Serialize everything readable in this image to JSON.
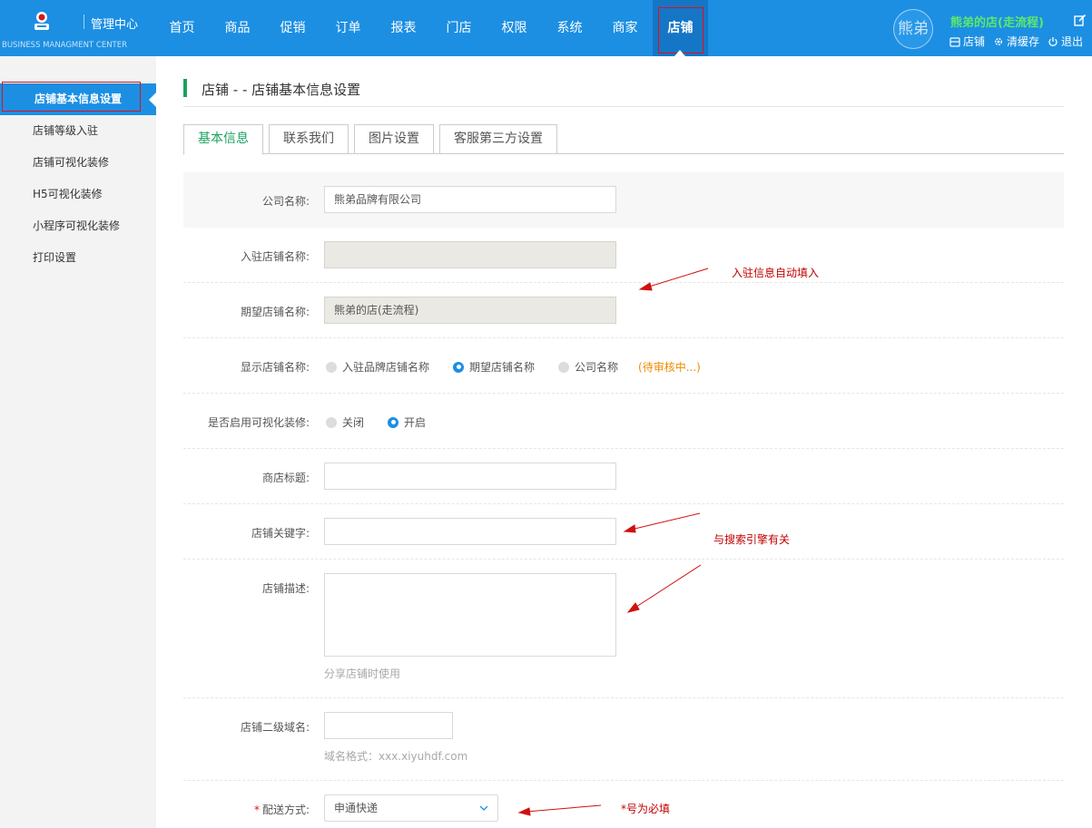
{
  "brand": {
    "title": "管理中心",
    "subtitle": "BUSINESS MANAGMENT CENTER"
  },
  "nav": {
    "items": [
      "首页",
      "商品",
      "促销",
      "订单",
      "报表",
      "门店",
      "权限",
      "系统",
      "商家",
      "店铺"
    ],
    "active": "店铺"
  },
  "user": {
    "avatar_text": "熊弟",
    "shop_name": "熊弟的店(走流程)",
    "links": [
      {
        "icon": "store-icon",
        "label": "店铺"
      },
      {
        "icon": "gear-icon",
        "label": "清缓存"
      },
      {
        "icon": "power-icon",
        "label": "退出"
      }
    ]
  },
  "sidebar": {
    "items": [
      "店铺基本信息设置",
      "店铺等级入驻",
      "店铺可视化装修",
      "H5可视化装修",
      "小程序可视化装修",
      "打印设置"
    ],
    "active": "店铺基本信息设置"
  },
  "page": {
    "title": "店铺 - - 店铺基本信息设置"
  },
  "tabs": {
    "items": [
      "基本信息",
      "联系我们",
      "图片设置",
      "客服第三方设置"
    ],
    "active": "基本信息"
  },
  "form": {
    "company_name": {
      "label": "公司名称:",
      "value": "熊弟品牌有限公司"
    },
    "settled_store_name": {
      "label": "入驻店铺名称:",
      "value": ""
    },
    "expected_store_name": {
      "label": "期望店铺名称:",
      "value": "熊弟的店(走流程)"
    },
    "display_store_name": {
      "label": "显示店铺名称:",
      "options": [
        "入驻品牌店铺名称",
        "期望店铺名称",
        "公司名称"
      ],
      "selected": "期望店铺名称",
      "status": "(待审核中...)"
    },
    "visual_decoration": {
      "label": "是否启用可视化装修:",
      "options": [
        "关闭",
        "开启"
      ],
      "selected": "开启"
    },
    "store_title": {
      "label": "商店标题:",
      "value": ""
    },
    "store_keywords": {
      "label": "店铺关键字:",
      "value": ""
    },
    "store_description": {
      "label": "店铺描述:",
      "value": "",
      "hint": "分享店铺时使用"
    },
    "subdomain": {
      "label": "店铺二级域名:",
      "value": "",
      "hint": "域名格式：xxx.xiyuhdf.com"
    },
    "delivery": {
      "required_mark": "*",
      "label": "配送方式:",
      "value": "申通快递"
    }
  },
  "annotations": {
    "auto_fill": "入驻信息自动填入",
    "seo": "与搜索引擎有关",
    "required": "*号为必填"
  },
  "colors": {
    "topbar": "#1c8fe3",
    "accent_green": "#19a15f",
    "shop_name": "#5de86a",
    "highlight_red": "#e0101a",
    "pending_orange": "#f08b00"
  }
}
